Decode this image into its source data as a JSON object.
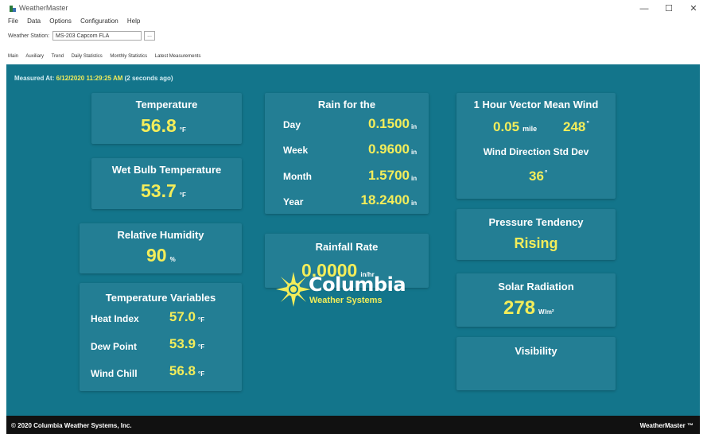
{
  "window": {
    "title": "WeatherMaster",
    "minimize": "—",
    "maximize": "☐",
    "close": "✕"
  },
  "menu": [
    "File",
    "Data",
    "Options",
    "Configuration",
    "Help"
  ],
  "station": {
    "label": "Weather Station:",
    "value": "MS-203 Capcom FLA",
    "button": "..."
  },
  "tabs": [
    "Main",
    "Auxiliary",
    "Trend",
    "Daily Statistics",
    "Monthly Statistics",
    "Latest Measurements"
  ],
  "measured": {
    "label": "Measured At:",
    "time": "6/12/2020 11:29:25 AM",
    "ago": "(2 seconds ago)"
  },
  "temperature": {
    "title": "Temperature",
    "value": "56.8",
    "unit": "°F"
  },
  "wet_bulb": {
    "title": "Wet Bulb Temperature",
    "value": "53.7",
    "unit": "°F"
  },
  "humidity": {
    "title": "Relative Humidity",
    "value": "90",
    "unit": "%"
  },
  "temp_vars": {
    "title": "Temperature Variables",
    "rows": [
      {
        "label": "Heat Index",
        "value": "57.0",
        "unit": "°F"
      },
      {
        "label": "Dew Point",
        "value": "53.9",
        "unit": "°F"
      },
      {
        "label": "Wind Chill",
        "value": "56.8",
        "unit": "°F"
      }
    ]
  },
  "rain": {
    "title": "Rain for the",
    "rows": [
      {
        "label": "Day",
        "value": "0.1500",
        "unit": "in"
      },
      {
        "label": "Week",
        "value": "0.9600",
        "unit": "in"
      },
      {
        "label": "Month",
        "value": "1.5700",
        "unit": "in"
      },
      {
        "label": "Year",
        "value": "18.2400",
        "unit": "in"
      }
    ]
  },
  "rain_rate": {
    "title": "Rainfall Rate",
    "value": "0.0000",
    "unit": "in/hr"
  },
  "wind": {
    "title": "1 Hour Vector Mean Wind",
    "speed": "0.05",
    "speed_unit": "mile",
    "direction": "248",
    "deg": "°",
    "std_title": "Wind Direction Std Dev",
    "std_value": "36",
    "std_deg": "°"
  },
  "pressure": {
    "title": "Pressure Tendency",
    "value": "Rising"
  },
  "solar": {
    "title": "Solar Radiation",
    "value": "278",
    "unit": "W/m²"
  },
  "visibility": {
    "title": "Visibility"
  },
  "logo": {
    "name": "Columbia",
    "sub": "Weather Systems"
  },
  "footer": {
    "copyright": "© 2020 Columbia Weather Systems, Inc.",
    "product": "WeatherMaster ™"
  },
  "colors": {
    "background": "#13758b",
    "panel": "#237e94",
    "value": "#f3ed5a",
    "label": "#ffffff"
  }
}
